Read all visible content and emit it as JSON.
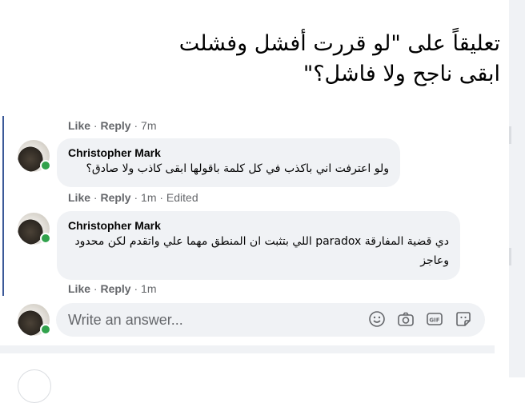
{
  "title": {
    "line1": "تعليقاً على \"لو قررت أفشل وفشلت",
    "line2": "ابقى ناجح ولا فاشل؟\""
  },
  "comments": [
    {
      "meta": {
        "like": "Like",
        "reply": "Reply",
        "time": "7m"
      }
    },
    {
      "author": "Christopher Mark",
      "text": "ولو اعترفت اني باكذب في كل كلمة باقولها ابقى كاذب ولا صادق؟",
      "meta": {
        "like": "Like",
        "reply": "Reply",
        "time": "1m · Edited"
      }
    },
    {
      "author": "Christopher Mark",
      "text": "دي قضية المفارقة paradox اللي بتثبت ان المنطق مهما علي واتقدم لكن محدود وعاجز",
      "meta": {
        "like": "Like",
        "reply": "Reply",
        "time": "1m"
      }
    }
  ],
  "composer": {
    "placeholder": "Write an answer...",
    "icons": [
      "emoji-icon",
      "camera-icon",
      "gif-icon",
      "sticker-icon"
    ]
  },
  "colors": {
    "bubble": "#f0f2f5",
    "meta": "#65676b",
    "online": "#31a24c",
    "thread": "#3b5998"
  }
}
